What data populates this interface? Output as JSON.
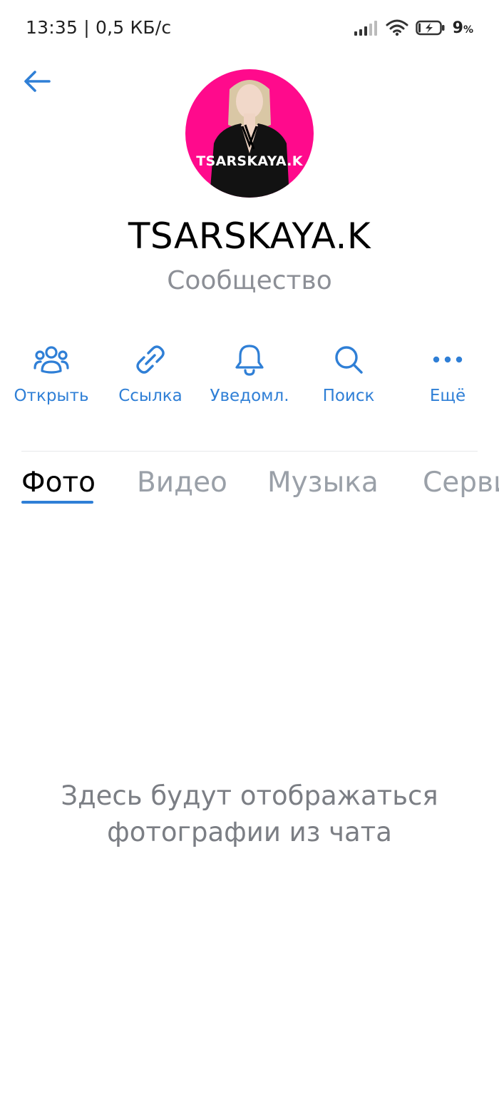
{
  "status_bar": {
    "time_speed": "13:35 | 0,5 КБ/с",
    "battery_value": "9",
    "battery_unit": "%",
    "icons": [
      "signal-icon",
      "wifi-icon",
      "battery-charging-icon"
    ]
  },
  "header": {
    "back_icon": "arrow-left-icon",
    "avatar_text": "TSARSKAYA.K",
    "title": "TSARSKAYA.K",
    "subtitle": "Сообщество"
  },
  "actions": [
    {
      "label": "Открыть",
      "icon": "people-icon"
    },
    {
      "label": "Ссылка",
      "icon": "link-icon"
    },
    {
      "label": "Уведомл.",
      "icon": "bell-icon"
    },
    {
      "label": "Поиск",
      "icon": "search-icon"
    },
    {
      "label": "Ещё",
      "icon": "more-icon"
    }
  ],
  "tabs": [
    {
      "label": "Фото",
      "active": true
    },
    {
      "label": "Видео",
      "active": false
    },
    {
      "label": "Музыка",
      "active": false
    },
    {
      "label": "Серви",
      "active": false
    }
  ],
  "empty_state": {
    "line1": "Здесь будут отображаться",
    "line2": "фотографии из чата"
  },
  "colors": {
    "accent": "#2f7fd6",
    "avatar_bg": "#ff0a8c",
    "muted_text": "#8c8f96"
  }
}
